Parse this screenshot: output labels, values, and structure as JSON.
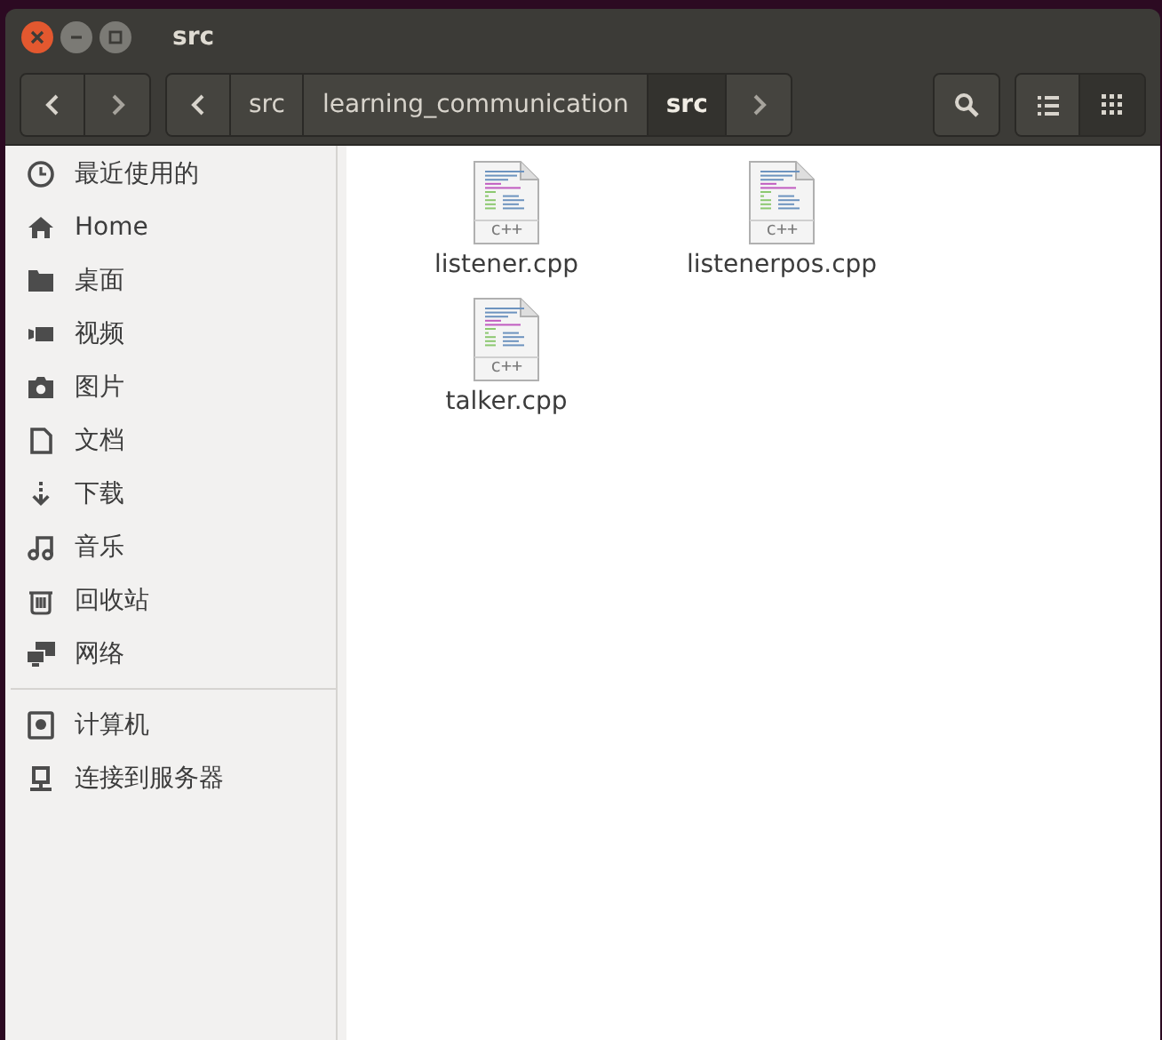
{
  "window": {
    "title": "src"
  },
  "toolbar": {
    "path": [
      {
        "label": "src",
        "selected": false
      },
      {
        "label": "learning_communication",
        "selected": false
      },
      {
        "label": "src",
        "selected": true
      }
    ],
    "view_buttons": [
      {
        "kind": "list",
        "selected": false
      },
      {
        "kind": "grid",
        "selected": true
      }
    ]
  },
  "sidebar": {
    "places": [
      {
        "kind": "recent",
        "label": "最近使用的"
      },
      {
        "kind": "home",
        "label": "Home"
      },
      {
        "kind": "folder",
        "label": "桌面"
      },
      {
        "kind": "video",
        "label": "视频"
      },
      {
        "kind": "camera",
        "label": "图片"
      },
      {
        "kind": "document",
        "label": "文档"
      },
      {
        "kind": "download",
        "label": "下载"
      },
      {
        "kind": "music",
        "label": "音乐"
      },
      {
        "kind": "trash",
        "label": "回收站"
      },
      {
        "kind": "network",
        "label": "网络"
      }
    ],
    "devices": [
      {
        "kind": "disk",
        "label": "计算机"
      },
      {
        "kind": "server",
        "label": "连接到服务器"
      }
    ]
  },
  "files": [
    {
      "name": "listener.cpp",
      "icon_text": "c++"
    },
    {
      "name": "listenerpos.cpp",
      "icon_text": "c++"
    },
    {
      "name": "talker.cpp",
      "icon_text": "c++"
    }
  ]
}
